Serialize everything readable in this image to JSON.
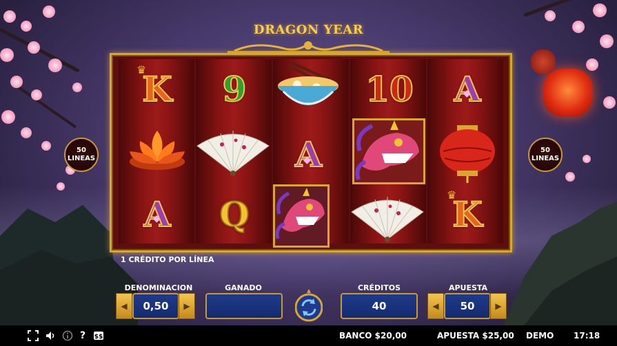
{
  "game": {
    "title": "DRAGON YEAR"
  },
  "paylines": {
    "left_count": "50",
    "left_label": "LINEAS",
    "right_count": "50",
    "right_label": "LINEAS"
  },
  "reels": [
    [
      "K",
      "lotus",
      "A"
    ],
    [
      "9",
      "fan",
      "Q"
    ],
    [
      "noodle-bowl",
      "A",
      "dragon"
    ],
    [
      "10",
      "dragon",
      "fan"
    ],
    [
      "A",
      "lantern",
      "K"
    ]
  ],
  "info": {
    "credit_per_line": "1 CRÉDITO POR LÍNEA"
  },
  "controls": {
    "denomination_label": "DENOMINACION",
    "denomination_value": "0,50",
    "won_label": "GANADO",
    "won_value": "",
    "credits_label": "CRÉDITOS",
    "credits_value": "40",
    "bet_label": "APUESTA",
    "bet_value": "50"
  },
  "status_bar": {
    "bank": "BANCO $20,00",
    "bet": "APUESTA $25,00",
    "mode": "DEMO",
    "time": "17:18"
  },
  "colors": {
    "reel_red": "#9c1a1a",
    "gold": "#d9a630",
    "field_blue": "#1f3a8a",
    "bar_black": "#000000"
  }
}
